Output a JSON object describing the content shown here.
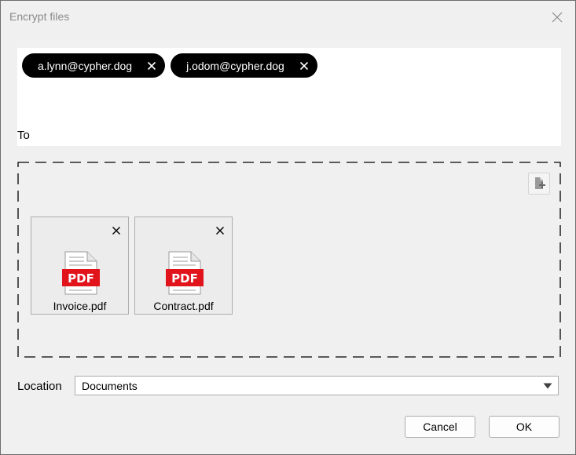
{
  "window": {
    "title": "Encrypt files"
  },
  "recipients": {
    "to_label": "To",
    "chips": [
      {
        "label": "a.lynn@cypher.dog"
      },
      {
        "label": "j.odom@cypher.dog"
      }
    ]
  },
  "files": {
    "items": [
      {
        "name": "Invoice.pdf",
        "type_badge": "PDF"
      },
      {
        "name": "Contract.pdf",
        "type_badge": "PDF"
      }
    ],
    "add_icon": "add-file-icon"
  },
  "location": {
    "label": "Location",
    "selected": "Documents"
  },
  "buttons": {
    "cancel": "Cancel",
    "ok": "OK"
  },
  "colors": {
    "chip_bg": "#000000",
    "pdf_red": "#e1141c",
    "window_bg": "#f0f0f0"
  }
}
